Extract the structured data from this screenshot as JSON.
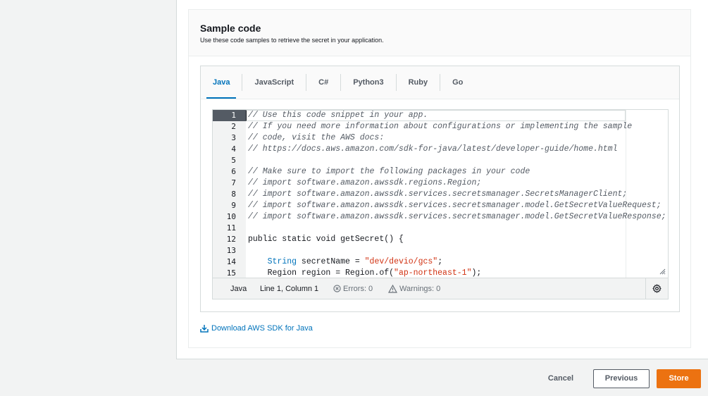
{
  "section": {
    "title": "Sample code",
    "description": "Use these code samples to retrieve the secret in your application."
  },
  "tabs": [
    {
      "label": "Java",
      "active": true
    },
    {
      "label": "JavaScript",
      "active": false
    },
    {
      "label": "C#",
      "active": false
    },
    {
      "label": "Python3",
      "active": false
    },
    {
      "label": "Ruby",
      "active": false
    },
    {
      "label": "Go",
      "active": false
    }
  ],
  "editor": {
    "lines": [
      {
        "n": "1",
        "text": "// Use this code snippet in your app.",
        "type": "comment"
      },
      {
        "n": "2",
        "text": "// If you need more information about configurations or implementing the sample",
        "type": "comment"
      },
      {
        "n": "3",
        "text": "// code, visit the AWS docs:",
        "type": "comment"
      },
      {
        "n": "4",
        "text": "// https://docs.aws.amazon.com/sdk-for-java/latest/developer-guide/home.html",
        "type": "comment"
      },
      {
        "n": "5",
        "text": "",
        "type": "code"
      },
      {
        "n": "6",
        "text": "// Make sure to import the following packages in your code",
        "type": "comment"
      },
      {
        "n": "7",
        "text": "// import software.amazon.awssdk.regions.Region;",
        "type": "comment"
      },
      {
        "n": "8",
        "text": "// import software.amazon.awssdk.services.secretsmanager.SecretsManagerClient;",
        "type": "comment"
      },
      {
        "n": "9",
        "text": "// import software.amazon.awssdk.services.secretsmanager.model.GetSecretValueRequest;",
        "type": "comment"
      },
      {
        "n": "10",
        "text": "// import software.amazon.awssdk.services.secretsmanager.model.GetSecretValueResponse;",
        "type": "comment"
      },
      {
        "n": "11",
        "text": "",
        "type": "code"
      },
      {
        "n": "12",
        "text": "public static void getSecret() {",
        "type": "code"
      },
      {
        "n": "13",
        "text": "",
        "type": "code"
      },
      {
        "n": "14",
        "text": "",
        "type": "line14",
        "indent": "    ",
        "kw": "String",
        "mid": " secretName = ",
        "str": "\"dev/devio/gcs\"",
        "end": ";"
      },
      {
        "n": "15",
        "text": "",
        "type": "line15",
        "indent": "    ",
        "pre": "Region region = Region.of(",
        "str": "\"ap-northeast-1\"",
        "end": ");"
      }
    ],
    "status": {
      "language": "Java",
      "position": "Line 1, Column 1",
      "errors": "Errors: 0",
      "warnings": "Warnings: 0"
    }
  },
  "download_link": "Download AWS SDK for Java",
  "footer": {
    "cancel": "Cancel",
    "previous": "Previous",
    "store": "Store"
  },
  "colors": {
    "accent": "#0073bb",
    "primary_button": "#ec7211",
    "string": "#d13212"
  }
}
